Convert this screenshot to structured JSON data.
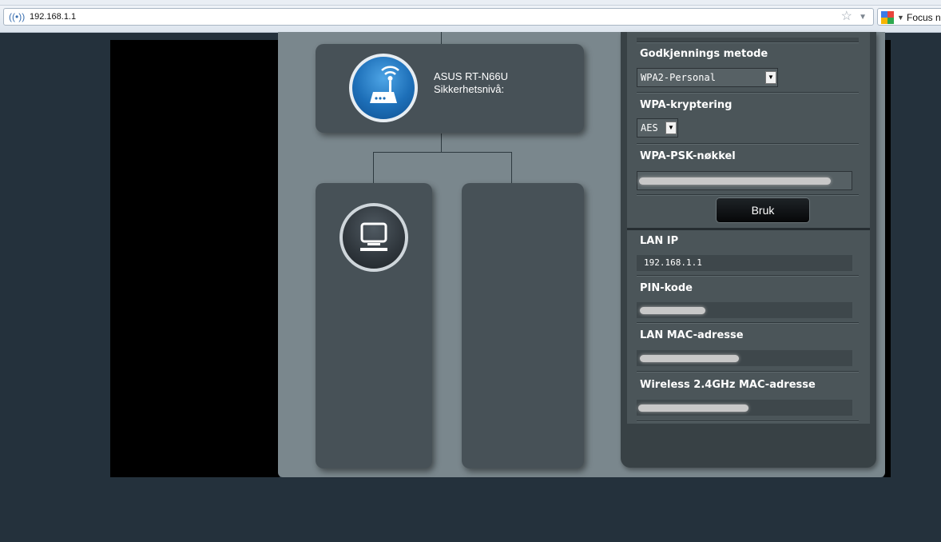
{
  "browser": {
    "url": "192.168.1.1",
    "search_engine_text": "Focus na"
  },
  "network_map": {
    "router": {
      "name": "ASUS RT-N66U",
      "security_label": "Sikkerhetsnivå:"
    }
  },
  "side_panel": {
    "auth_method": {
      "label": "Godkjennings metode",
      "value": "WPA2-Personal"
    },
    "wpa_encryption": {
      "label": "WPA-kryptering",
      "value": "AES"
    },
    "wpa_psk_key": {
      "label": "WPA-PSK-nøkkel"
    },
    "apply_button": "Bruk",
    "lan_ip": {
      "label": "LAN IP",
      "value": "192.168.1.1"
    },
    "pin_code": {
      "label": "PIN-kode"
    },
    "lan_mac": {
      "label": "LAN MAC-adresse"
    },
    "wireless_mac": {
      "label": "Wireless 2.4GHz MAC-adresse"
    }
  },
  "colors": {
    "page_background": "#24313c",
    "map_background": "#7a878d",
    "panel": "#475157",
    "router_icon": "#1d6fb8"
  }
}
